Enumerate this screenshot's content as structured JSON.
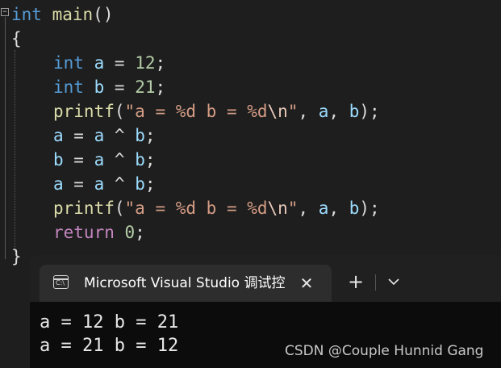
{
  "editor": {
    "lines": [
      {
        "tokens": [
          {
            "t": "int",
            "c": "kw"
          },
          {
            "t": " ",
            "c": "pun"
          },
          {
            "t": "main",
            "c": "fn"
          },
          {
            "t": "()",
            "c": "pun"
          }
        ]
      },
      {
        "tokens": [
          {
            "t": "{",
            "c": "pun"
          }
        ]
      },
      {
        "tokens": [
          {
            "t": "int",
            "c": "kw"
          },
          {
            "t": " ",
            "c": "pun"
          },
          {
            "t": "a",
            "c": "var"
          },
          {
            "t": " = ",
            "c": "pun"
          },
          {
            "t": "12",
            "c": "num"
          },
          {
            "t": ";",
            "c": "pun"
          }
        ]
      },
      {
        "tokens": [
          {
            "t": "int",
            "c": "kw"
          },
          {
            "t": " ",
            "c": "pun"
          },
          {
            "t": "b",
            "c": "var"
          },
          {
            "t": " = ",
            "c": "pun"
          },
          {
            "t": "21",
            "c": "num"
          },
          {
            "t": ";",
            "c": "pun"
          }
        ]
      },
      {
        "tokens": [
          {
            "t": "printf",
            "c": "fn"
          },
          {
            "t": "(",
            "c": "pun"
          },
          {
            "t": "\"a = %d b = %d",
            "c": "str"
          },
          {
            "t": "\\n",
            "c": "esc"
          },
          {
            "t": "\"",
            "c": "str"
          },
          {
            "t": ", ",
            "c": "pun"
          },
          {
            "t": "a",
            "c": "var"
          },
          {
            "t": ", ",
            "c": "pun"
          },
          {
            "t": "b",
            "c": "var"
          },
          {
            "t": ");",
            "c": "pun"
          }
        ]
      },
      {
        "tokens": [
          {
            "t": "a",
            "c": "var"
          },
          {
            "t": " = ",
            "c": "pun"
          },
          {
            "t": "a",
            "c": "var"
          },
          {
            "t": " ^ ",
            "c": "pun"
          },
          {
            "t": "b",
            "c": "var"
          },
          {
            "t": ";",
            "c": "pun"
          }
        ]
      },
      {
        "tokens": [
          {
            "t": "b",
            "c": "var"
          },
          {
            "t": " = ",
            "c": "pun"
          },
          {
            "t": "a",
            "c": "var"
          },
          {
            "t": " ^ ",
            "c": "pun"
          },
          {
            "t": "b",
            "c": "var"
          },
          {
            "t": ";",
            "c": "pun"
          }
        ]
      },
      {
        "tokens": [
          {
            "t": "a",
            "c": "var"
          },
          {
            "t": " = ",
            "c": "pun"
          },
          {
            "t": "a",
            "c": "var"
          },
          {
            "t": " ^ ",
            "c": "pun"
          },
          {
            "t": "b",
            "c": "var"
          },
          {
            "t": ";",
            "c": "pun"
          }
        ]
      },
      {
        "tokens": [
          {
            "t": "printf",
            "c": "fn"
          },
          {
            "t": "(",
            "c": "pun"
          },
          {
            "t": "\"a = %d b = %d",
            "c": "str"
          },
          {
            "t": "\\n",
            "c": "esc"
          },
          {
            "t": "\"",
            "c": "str"
          },
          {
            "t": ", ",
            "c": "pun"
          },
          {
            "t": "a",
            "c": "var"
          },
          {
            "t": ", ",
            "c": "pun"
          },
          {
            "t": "b",
            "c": "var"
          },
          {
            "t": ");",
            "c": "pun"
          }
        ]
      },
      {
        "tokens": [
          {
            "t": "return",
            "c": "ctl"
          },
          {
            "t": " ",
            "c": "pun"
          },
          {
            "t": "0",
            "c": "num"
          },
          {
            "t": ";",
            "c": "pun"
          }
        ]
      },
      {
        "tokens": [
          {
            "t": "}",
            "c": "pun"
          }
        ]
      }
    ]
  },
  "terminal": {
    "tab_title": "Microsoft Visual Studio 调试控制台",
    "tab_icon_label": "C:\\",
    "close_glyph": "✕",
    "new_tab_glyph": "+",
    "icons": {
      "tab": "console-icon",
      "close": "close-icon",
      "new_tab": "plus-icon",
      "dropdown": "chevron-down-icon"
    },
    "output": [
      "a = 12 b = 21",
      "a = 21 b = 12"
    ]
  },
  "watermark": "CSDN @Couple Hunnid Gang",
  "colors": {
    "editor_bg": "#1e1e1e",
    "keyword": "#569cd6",
    "function": "#dcdcaa",
    "variable": "#9cdcfe",
    "number": "#b5cea8",
    "string": "#d69d85",
    "control": "#c586c0",
    "terminal_bg": "#0c0c0c",
    "tab_bg": "#2d2d2d"
  }
}
